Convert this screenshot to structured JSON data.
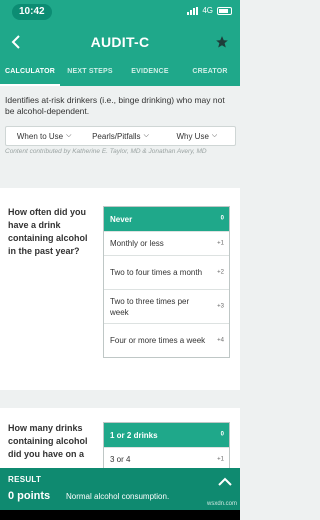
{
  "status": {
    "time": "10:42",
    "network": "4G"
  },
  "header": {
    "title": "AUDIT-C"
  },
  "tabs": [
    "CALCULATOR",
    "NEXT STEPS",
    "EVIDENCE",
    "CREATOR"
  ],
  "info": {
    "description": "Identifies at-risk drinkers (i.e., binge drinking) who may not be alcohol-dependent.",
    "buttons": [
      "When to Use",
      "Pearls/Pitfalls",
      "Why Use"
    ],
    "credit": "Content contributed by Katherine E. Taylor, MD & Jonathan Avery, MD"
  },
  "questions": [
    {
      "text": "How often did you have a drink containing alcohol in the past year?",
      "options": [
        {
          "label": "Never",
          "points": "0",
          "selected": true
        },
        {
          "label": "Monthly or less",
          "points": "+1"
        },
        {
          "label": "Two to four times a month",
          "points": "+2"
        },
        {
          "label": "Two to three times per week",
          "points": "+3"
        },
        {
          "label": "Four or more times a week",
          "points": "+4"
        }
      ]
    },
    {
      "text": "How many drinks containing alcohol did you have on a",
      "options": [
        {
          "label": "1 or 2 drinks",
          "points": "0",
          "selected": true
        },
        {
          "label": "3 or 4",
          "points": "+1"
        }
      ]
    }
  ],
  "result": {
    "label": "RESULT",
    "points": "0 points",
    "description": "Normal alcohol consumption.",
    "watermark": "wsxdn.com"
  },
  "colors": {
    "accent": "#1fa88a",
    "result_bg": "#0f8a70"
  }
}
